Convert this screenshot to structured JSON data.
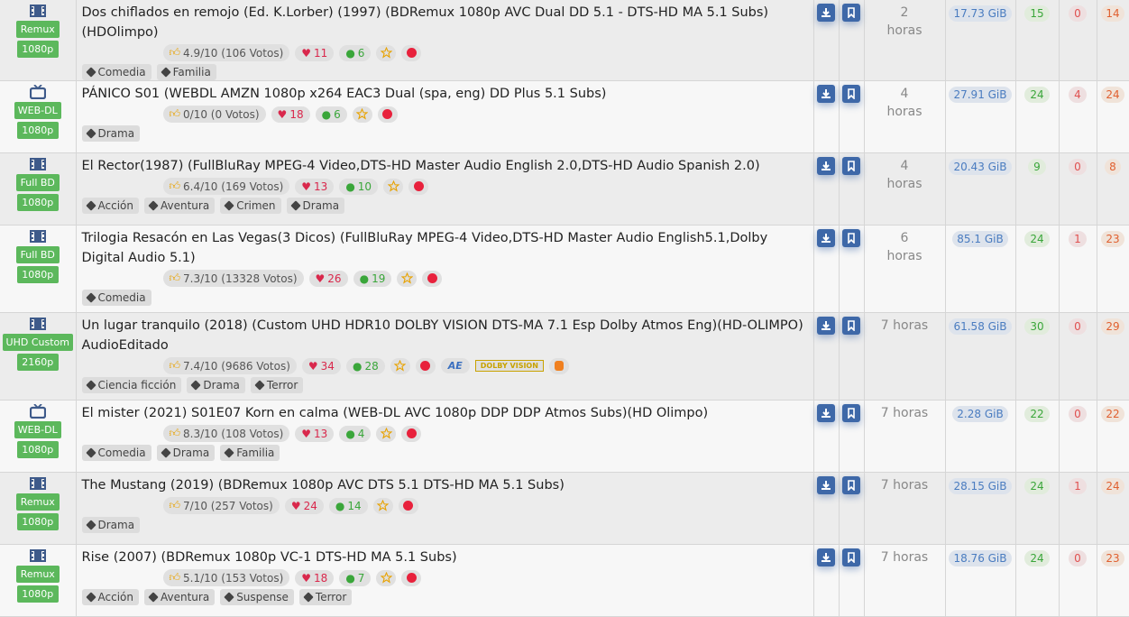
{
  "colors": {
    "accent": "#5cb85c",
    "button": "#3e68a8",
    "likes": "#d9284c",
    "comments": "#3aa63a",
    "size": "#4a7cc0",
    "leechers": "#e05050",
    "completed": "#e06030"
  },
  "rows": [
    {
      "category_icon": "film-icon",
      "type": "Remux",
      "resolution": "1080p",
      "title": "Dos chiflados en remojo (Ed. K.Lorber) (1997) (BDRemux 1080p AVC Dual DD 5.1 - DTS-HD MA 5.1 Subs) (HDOlimpo)",
      "rating": "4.9/10 (106 Votos)",
      "likes": "11",
      "comments": "6",
      "tags": [
        "Comedia",
        "Familia"
      ],
      "age_value": "2",
      "age_unit": "horas",
      "size": "17.73 GiB",
      "seeders": "15",
      "leechers": "0",
      "completed": "14"
    },
    {
      "category_icon": "tv-icon",
      "type": "WEB-DL",
      "resolution": "1080p",
      "title": "PÁNICO S01 (WEBDL AMZN 1080p x264 EAC3 Dual (spa, eng) DD Plus 5.1 Subs)",
      "rating": "0/10 (0 Votos)",
      "likes": "18",
      "comments": "6",
      "tags": [
        "Drama"
      ],
      "age_value": "4",
      "age_unit": "horas",
      "size": "27.91 GiB",
      "seeders": "24",
      "leechers": "4",
      "completed": "24"
    },
    {
      "category_icon": "film-icon",
      "type": "Full BD",
      "resolution": "1080p",
      "title": "El Rector(1987) (FullBluRay MPEG-4 Video,DTS-HD Master Audio English 2.0,DTS-HD Audio Spanish 2.0)",
      "rating": "6.4/10 (169 Votos)",
      "likes": "13",
      "comments": "10",
      "tags": [
        "Acción",
        "Aventura",
        "Crimen",
        "Drama"
      ],
      "age_value": "4",
      "age_unit": "horas",
      "size": "20.43 GiB",
      "seeders": "9",
      "leechers": "0",
      "completed": "8"
    },
    {
      "category_icon": "film-icon",
      "type": "Full BD",
      "resolution": "1080p",
      "title": "Trilogia Resacón en Las Vegas(3 Dicos) (FullBluRay MPEG-4 Video,DTS-HD Master Audio English5.1,Dolby Digital Audio 5.1)",
      "rating": "7.3/10 (13328 Votos)",
      "likes": "26",
      "comments": "19",
      "tags": [
        "Comedia"
      ],
      "age_value": "6",
      "age_unit": "horas",
      "size": "85.1 GiB",
      "seeders": "24",
      "leechers": "1",
      "completed": "23"
    },
    {
      "category_icon": "film-icon",
      "type": "UHD Custom",
      "resolution": "2160p",
      "title": "Un lugar tranquilo (2018) (Custom UHD HDR10 DOLBY VISION DTS-MA 7.1 Esp Dolby Atmos Eng)(HD-OLIMPO) AudioEditado",
      "rating": "7.4/10 (9686 Votos)",
      "likes": "34",
      "comments": "28",
      "badge_ae": "AE",
      "badge_dolby": "DOLBY VISION",
      "tags": [
        "Ciencia ficción",
        "Drama",
        "Terror"
      ],
      "age_value": "7 horas",
      "age_unit": "",
      "size": "61.58 GiB",
      "seeders": "30",
      "leechers": "0",
      "completed": "29"
    },
    {
      "category_icon": "tv-icon",
      "type": "WEB-DL",
      "resolution": "1080p",
      "title": "El mister (2021) S01E07 Korn en calma (WEB-DL AVC 1080p DDP DDP Atmos Subs)(HD Olimpo)",
      "rating": "8.3/10 (108 Votos)",
      "likes": "13",
      "comments": "4",
      "tags": [
        "Comedia",
        "Drama",
        "Familia"
      ],
      "age_value": "7 horas",
      "age_unit": "",
      "size": "2.28 GiB",
      "seeders": "22",
      "leechers": "0",
      "completed": "22"
    },
    {
      "category_icon": "film-icon",
      "type": "Remux",
      "resolution": "1080p",
      "title": "The Mustang (2019) (BDRemux 1080p AVC DTS 5.1 DTS-HD MA 5.1 Subs)",
      "rating": "7/10 (257 Votos)",
      "likes": "24",
      "comments": "14",
      "tags": [
        "Drama"
      ],
      "age_value": "7 horas",
      "age_unit": "",
      "size": "28.15 GiB",
      "seeders": "24",
      "leechers": "1",
      "completed": "24"
    },
    {
      "category_icon": "film-icon",
      "type": "Remux",
      "resolution": "1080p",
      "title": "Rise (2007) (BDRemux 1080p VC-1 DTS-HD MA 5.1 Subs)",
      "rating": "5.1/10 (153 Votos)",
      "likes": "18",
      "comments": "7",
      "tags": [
        "Acción",
        "Aventura",
        "Suspense",
        "Terror"
      ],
      "age_value": "7 horas",
      "age_unit": "",
      "size": "18.76 GiB",
      "seeders": "24",
      "leechers": "0",
      "completed": "23"
    }
  ]
}
